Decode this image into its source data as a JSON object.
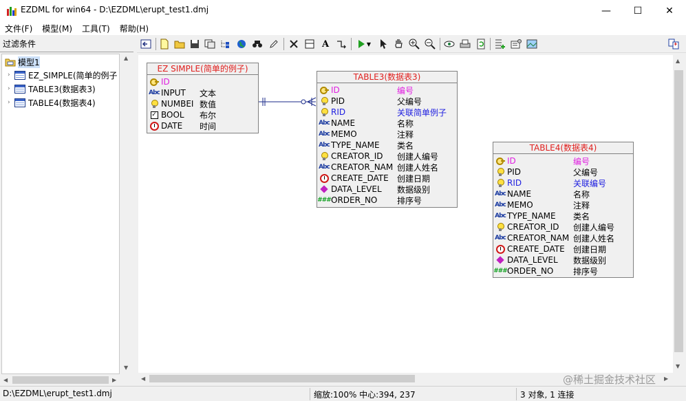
{
  "window": {
    "title": "EZDML for win64 - D:\\EZDML\\erupt_test1.dmj",
    "minimize": "—",
    "maximize": "☐",
    "close": "✕"
  },
  "menu": [
    "文件(F)",
    "模型(M)",
    "工具(T)",
    "帮助(H)"
  ],
  "left_panel": {
    "filter_label": "过滤条件",
    "tree": {
      "root": "模型1",
      "items": [
        "EZ_SIMPLE(简单的例子",
        "TABLE3(数据表3)",
        "TABLE4(数据表4)"
      ]
    }
  },
  "toolbar_icons": [
    "back-icon",
    "new-icon",
    "open-icon",
    "save-icon",
    "save-as-icon",
    "tree-icon",
    "globe-icon",
    "find-icon",
    "edit-icon",
    "delete-icon",
    "table-icon",
    "text-icon",
    "link-icon",
    "run-icon",
    "run-menu-icon",
    "pointer-icon",
    "hand-icon",
    "zoom-in-icon",
    "zoom-out-icon",
    "view-icon",
    "print-icon",
    "refresh-icon",
    "add-table-icon",
    "properties-icon",
    "image-icon",
    "switch-icon"
  ],
  "entities": {
    "ez_simple": {
      "title": "EZ SIMPLE(简单的例子)",
      "fields": [
        {
          "icon": "key",
          "name": "ID",
          "comment": "",
          "kind": "pk"
        },
        {
          "icon": "abc",
          "name": "INPUT",
          "comment": "文本",
          "kind": ""
        },
        {
          "icon": "bulb",
          "name": "NUMBEI",
          "comment": "数值",
          "kind": ""
        },
        {
          "icon": "check",
          "name": "BOOL",
          "comment": "布尔",
          "kind": ""
        },
        {
          "icon": "clock",
          "name": "DATE",
          "comment": "时间",
          "kind": ""
        }
      ]
    },
    "table3": {
      "title": "TABLE3(数据表3)",
      "fields": [
        {
          "icon": "key",
          "name": "ID",
          "comment": "编号",
          "kind": "pk"
        },
        {
          "icon": "bulb",
          "name": "PID",
          "comment": "父编号",
          "kind": ""
        },
        {
          "icon": "bulb",
          "name": "RID",
          "comment": "关联简单例子",
          "kind": "fk"
        },
        {
          "icon": "abc",
          "name": "NAME",
          "comment": "名称",
          "kind": ""
        },
        {
          "icon": "abc",
          "name": "MEMO",
          "comment": "注释",
          "kind": ""
        },
        {
          "icon": "abc",
          "name": "TYPE_NAME",
          "comment": "类名",
          "kind": ""
        },
        {
          "icon": "bulb",
          "name": "CREATOR_ID",
          "comment": "创建人编号",
          "kind": ""
        },
        {
          "icon": "abc",
          "name": "CREATOR_NAM",
          "comment": "创建人姓名",
          "kind": ""
        },
        {
          "icon": "clock",
          "name": "CREATE_DATE",
          "comment": "创建日期",
          "kind": ""
        },
        {
          "icon": "diamond",
          "name": "DATA_LEVEL",
          "comment": "数据级别",
          "kind": ""
        },
        {
          "icon": "num",
          "name": "ORDER_NO",
          "comment": "排序号",
          "kind": ""
        }
      ]
    },
    "table4": {
      "title": "TABLE4(数据表4)",
      "fields": [
        {
          "icon": "key",
          "name": "ID",
          "comment": "编号",
          "kind": "pk"
        },
        {
          "icon": "bulb",
          "name": "PID",
          "comment": "父编号",
          "kind": ""
        },
        {
          "icon": "bulb",
          "name": "RID",
          "comment": "关联编号",
          "kind": "fk"
        },
        {
          "icon": "abc",
          "name": "NAME",
          "comment": "名称",
          "kind": ""
        },
        {
          "icon": "abc",
          "name": "MEMO",
          "comment": "注释",
          "kind": ""
        },
        {
          "icon": "abc",
          "name": "TYPE_NAME",
          "comment": "类名",
          "kind": ""
        },
        {
          "icon": "bulb",
          "name": "CREATOR_ID",
          "comment": "创建人编号",
          "kind": ""
        },
        {
          "icon": "abc",
          "name": "CREATOR_NAM",
          "comment": "创建人姓名",
          "kind": ""
        },
        {
          "icon": "clock",
          "name": "CREATE_DATE",
          "comment": "创建日期",
          "kind": ""
        },
        {
          "icon": "diamond",
          "name": "DATA_LEVEL",
          "comment": "数据级别",
          "kind": ""
        },
        {
          "icon": "num",
          "name": "ORDER_NO",
          "comment": "排序号",
          "kind": ""
        }
      ]
    }
  },
  "colors": {
    "title_red": "#e0201e",
    "pk_magenta": "#e020e0",
    "fk_blue": "#2020e0",
    "link_line": "#1a2a8a"
  },
  "status": {
    "file": "D:\\EZDML\\erupt_test1.dmj",
    "zoom": "缩放:100% 中心:394, 237",
    "count": "3 对象, 1 连接"
  },
  "watermark": "@稀土掘金技术社区"
}
